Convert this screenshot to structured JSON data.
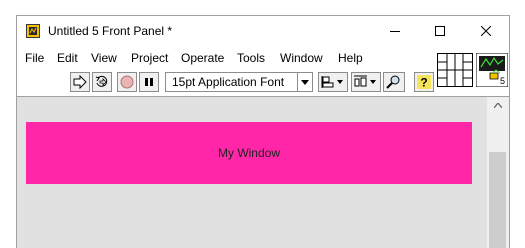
{
  "window": {
    "title": "Untitled 5 Front Panel *"
  },
  "menu": {
    "items": [
      "File",
      "Edit",
      "View",
      "Project",
      "Operate",
      "Tools",
      "Window",
      "Help"
    ]
  },
  "toolbar": {
    "font_selector": "15pt Application Font"
  },
  "panel": {
    "background": "#e1e1e1",
    "label": "My Window",
    "label_color": "#ff26a8"
  },
  "vi_icon": {
    "number": "5"
  }
}
